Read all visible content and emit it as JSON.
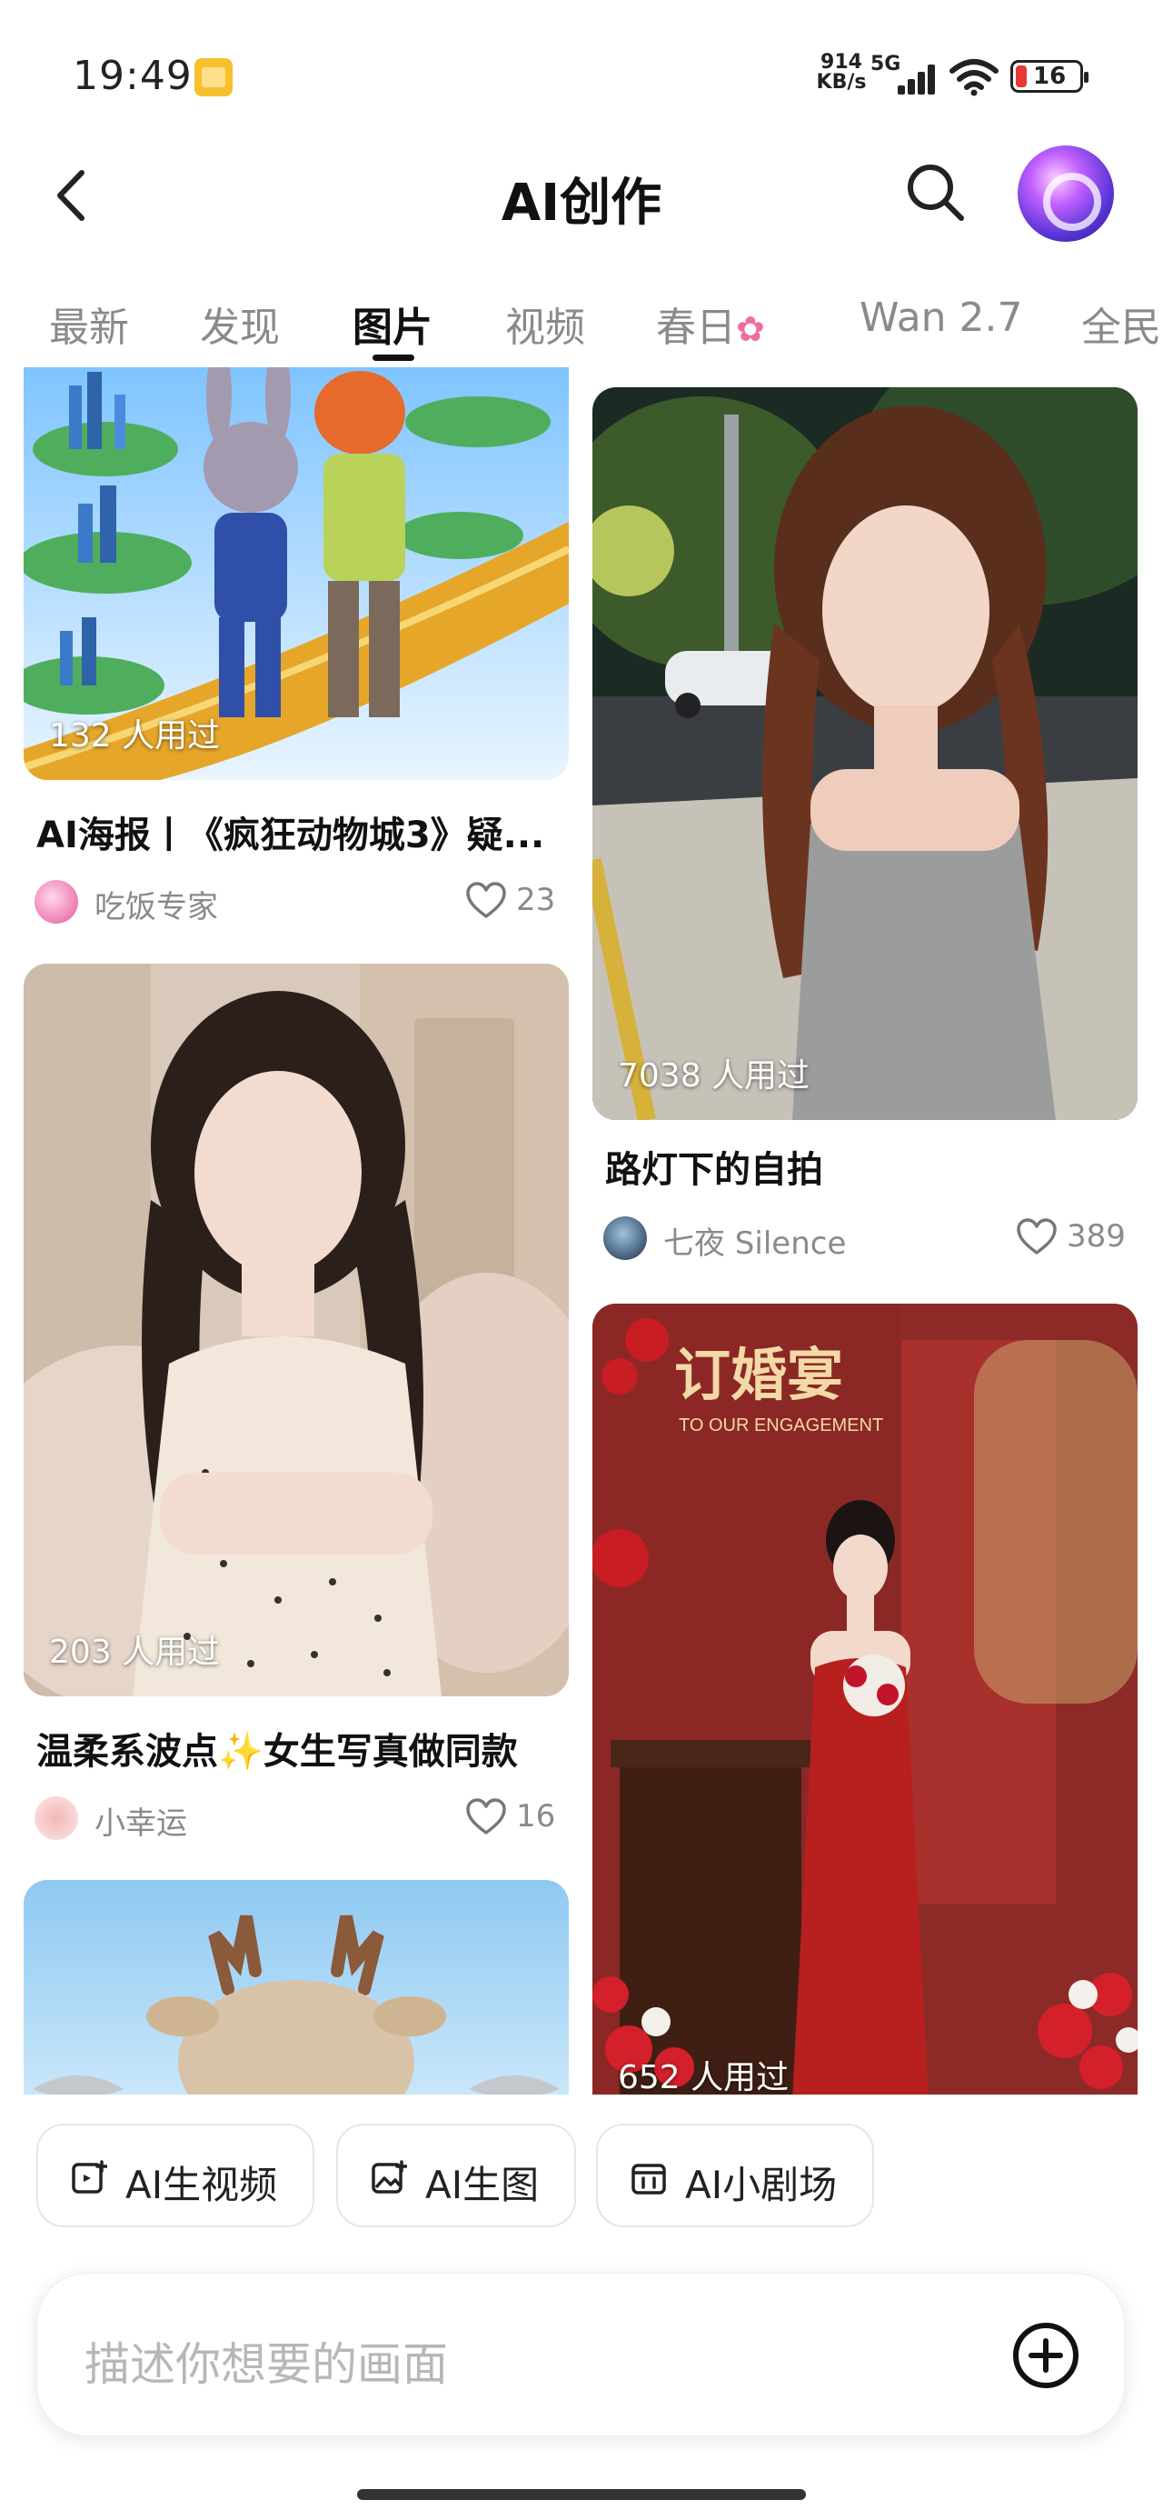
{
  "status_bar": {
    "time": "19:49",
    "net_speed_value": "914",
    "net_speed_unit": "KB/s",
    "network": "5G",
    "battery": "16",
    "battery_color": "#e53935"
  },
  "header": {
    "title": "AI创作",
    "back_icon": "chevron-left-icon",
    "search_icon": "search-icon",
    "avatar_icon": "ai-orb-avatar"
  },
  "tabs": [
    {
      "label": "最新",
      "active": false
    },
    {
      "label": "发现",
      "active": false
    },
    {
      "label": "图片",
      "active": true
    },
    {
      "label": "视频",
      "active": false
    },
    {
      "label": "春日",
      "active": false
    },
    {
      "label": "Wan 2.7",
      "active": false
    },
    {
      "label": "全民",
      "active": false
    }
  ],
  "feed": {
    "left": [
      {
        "usage": "132 人用过",
        "title": "AI海报丨《疯狂动物城3》疑...",
        "author": "吃饭专家",
        "likes": "23"
      },
      {
        "usage": "203 人用过",
        "title": "温柔系波点✨女生写真做同款",
        "author": "小幸运",
        "likes": "16"
      },
      {
        "usage": "",
        "title": "",
        "author": "",
        "likes": ""
      }
    ],
    "right": [
      {
        "usage": "7038 人用过",
        "title": "路灯下的自拍",
        "author": "七夜 Silence",
        "likes": "389"
      },
      {
        "usage": "652 人用过",
        "title": "",
        "author": "",
        "likes": "",
        "poster_title": "订婚宴",
        "poster_subtitle": "TO OUR ENGAGEMENT"
      }
    ]
  },
  "actions": [
    {
      "label": "AI生视频",
      "icon": "video-plus-icon"
    },
    {
      "label": "AI生图",
      "icon": "image-plus-icon"
    },
    {
      "label": "AI小剧场",
      "icon": "theater-icon"
    }
  ],
  "prompt": {
    "placeholder": "描述你想要的画面",
    "plus_icon": "plus-circle-icon"
  }
}
